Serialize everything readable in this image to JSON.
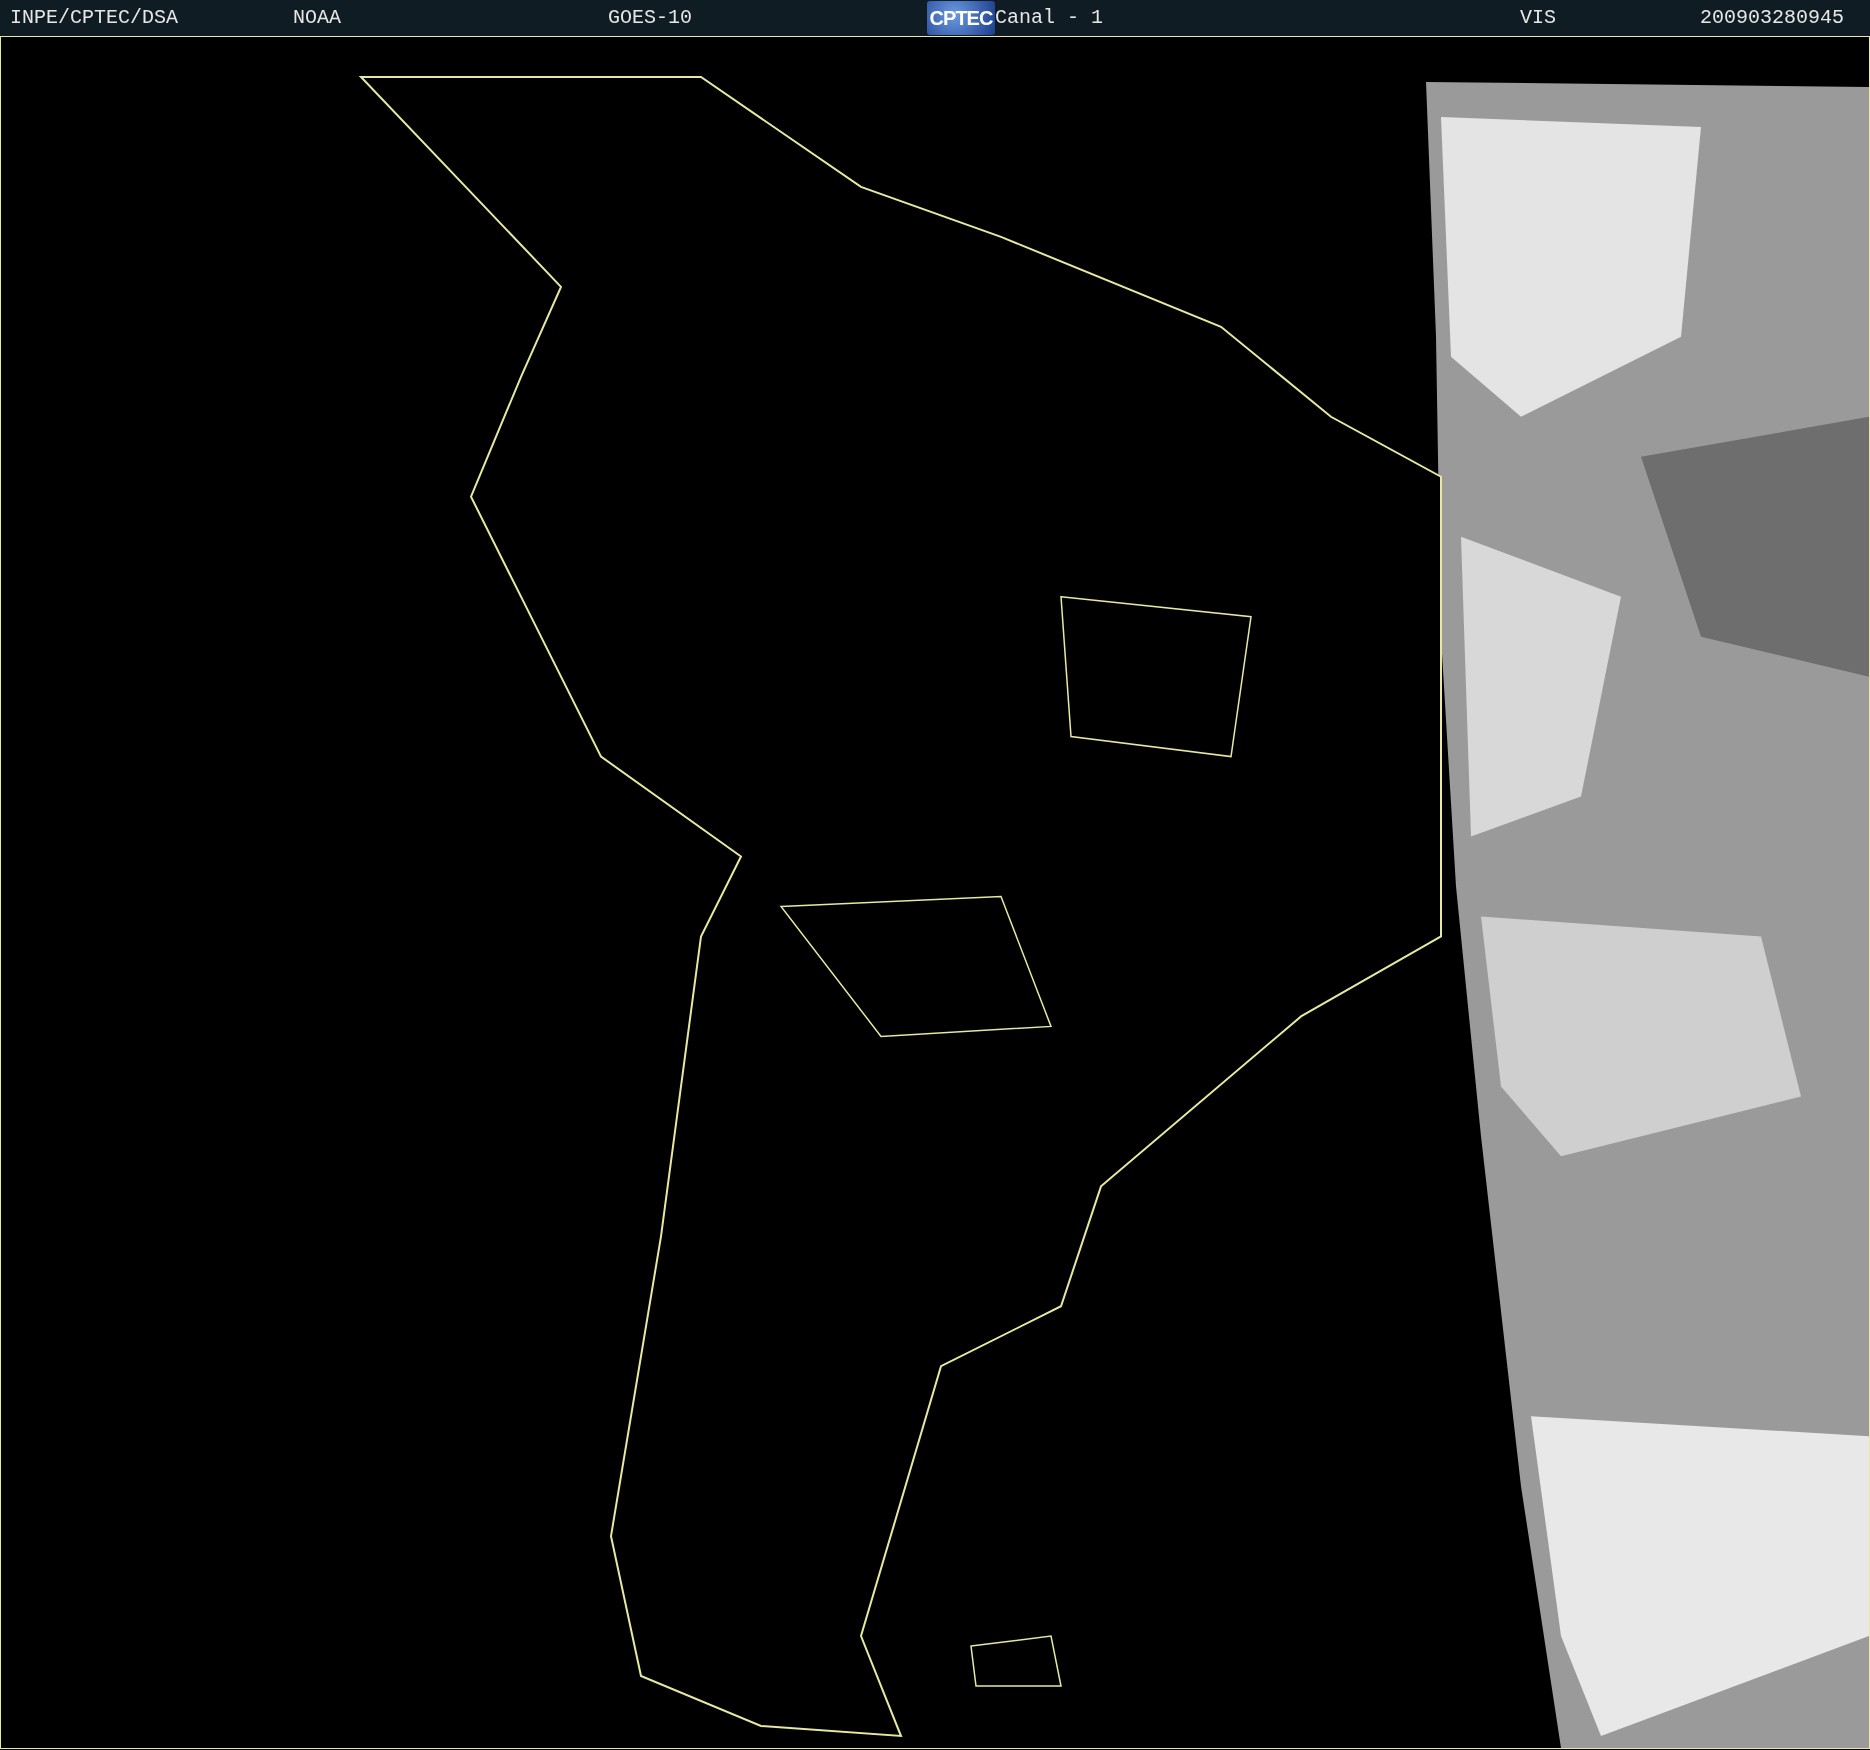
{
  "header": {
    "items": [
      {
        "kind": "text",
        "text": "INPE/CPTEC/DSA"
      },
      {
        "kind": "text",
        "text": "NOAA"
      },
      {
        "kind": "text",
        "text": "GOES-10"
      },
      {
        "kind": "logo",
        "text": "CPTEC"
      },
      {
        "kind": "text",
        "text": "Canal - 1"
      },
      {
        "kind": "text",
        "text": "VIS"
      },
      {
        "kind": "text",
        "text": "200903280945"
      }
    ]
  }
}
